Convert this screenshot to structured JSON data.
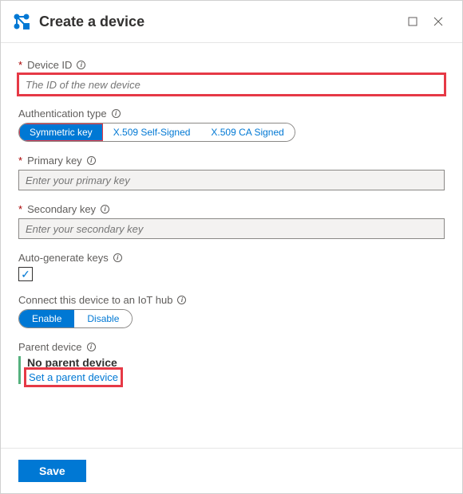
{
  "header": {
    "title": "Create a device"
  },
  "fields": {
    "deviceId": {
      "label": "Device ID",
      "placeholder": "The ID of the new device"
    },
    "authType": {
      "label": "Authentication type"
    },
    "authOptions": [
      "Symmetric key",
      "X.509 Self-Signed",
      "X.509 CA Signed"
    ],
    "authSelected": 0,
    "primaryKey": {
      "label": "Primary key",
      "placeholder": "Enter your primary key"
    },
    "secondaryKey": {
      "label": "Secondary key",
      "placeholder": "Enter your secondary key"
    },
    "autoGen": {
      "label": "Auto-generate keys",
      "checked": true
    },
    "connect": {
      "label": "Connect this device to an IoT hub"
    },
    "connectOptions": [
      "Enable",
      "Disable"
    ],
    "connectSelected": 0,
    "parent": {
      "label": "Parent device",
      "none": "No parent device",
      "link": "Set a parent device"
    }
  },
  "footer": {
    "save": "Save"
  },
  "colors": {
    "azureBlue": "#0078d4",
    "highlight": "#e63946"
  }
}
